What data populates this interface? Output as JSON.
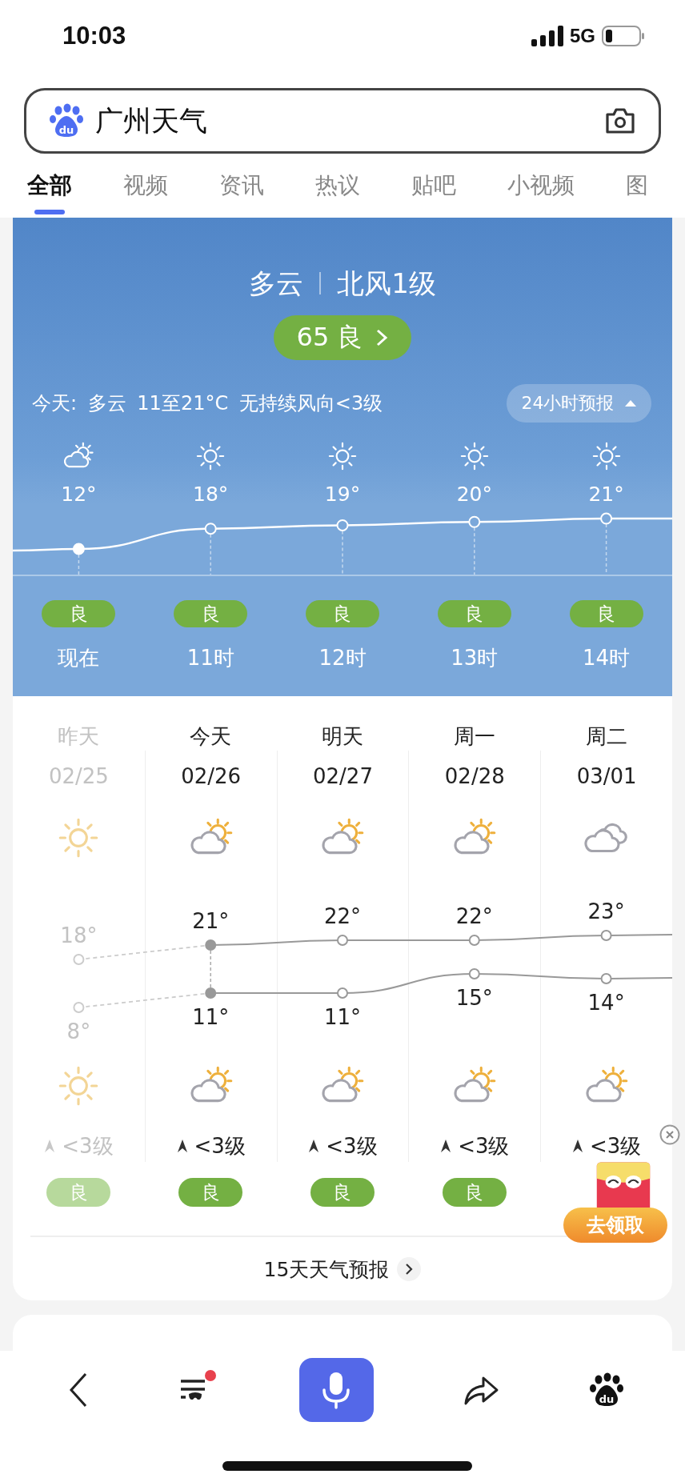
{
  "status_bar": {
    "time": "10:03",
    "network": "5G"
  },
  "search": {
    "logo_text": "du",
    "query": "广州天气"
  },
  "tabs": [
    {
      "label": "全部",
      "selected": true
    },
    {
      "label": "视频",
      "selected": false
    },
    {
      "label": "资讯",
      "selected": false
    },
    {
      "label": "热议",
      "selected": false
    },
    {
      "label": "贴吧",
      "selected": false
    },
    {
      "label": "小视频",
      "selected": false
    },
    {
      "label": "图",
      "selected": false
    }
  ],
  "current": {
    "condition": "多云",
    "wind": "北风1级",
    "aqi_value": "65",
    "aqi_label": "良"
  },
  "today_summary": "今天: 多云 11至21°C 无持续风向<3级",
  "forecast_button": {
    "label": "24小时预报",
    "expanded": true
  },
  "hourly": [
    {
      "weather": {
        "kind": "partly_cloudy"
      },
      "temp": "12°",
      "aqi": "良",
      "time": "现在",
      "selected": true
    },
    {
      "weather": {
        "kind": "sunny"
      },
      "temp": "18°",
      "aqi": "良",
      "time": "11时",
      "selected": false
    },
    {
      "weather": {
        "kind": "sunny"
      },
      "temp": "19°",
      "aqi": "良",
      "time": "12时",
      "selected": false
    },
    {
      "weather": {
        "kind": "sunny"
      },
      "temp": "20°",
      "aqi": "良",
      "time": "13时",
      "selected": false
    },
    {
      "weather": {
        "kind": "sunny"
      },
      "temp": "21°",
      "aqi": "良",
      "time": "14时",
      "selected": false
    }
  ],
  "daily": [
    {
      "day": "昨天",
      "date": "02/25",
      "day_weather": {
        "kind": "sunny"
      },
      "high": "18°",
      "low": "8°",
      "night_weather": {
        "kind": "sunny"
      },
      "wind": "<3级",
      "aqi": "良",
      "past": true,
      "selected": false
    },
    {
      "day": "今天",
      "date": "02/26",
      "day_weather": {
        "kind": "partly_cloudy"
      },
      "high": "21°",
      "low": "11°",
      "night_weather": {
        "kind": "partly_cloudy"
      },
      "wind": "<3级",
      "aqi": "良",
      "past": false,
      "selected": true
    },
    {
      "day": "明天",
      "date": "02/27",
      "day_weather": {
        "kind": "partly_cloudy"
      },
      "high": "22°",
      "low": "11°",
      "night_weather": {
        "kind": "partly_cloudy"
      },
      "wind": "<3级",
      "aqi": "良",
      "past": false,
      "selected": false
    },
    {
      "day": "周一",
      "date": "02/28",
      "day_weather": {
        "kind": "partly_cloudy"
      },
      "high": "22°",
      "low": "15°",
      "night_weather": {
        "kind": "partly_cloudy"
      },
      "wind": "<3级",
      "aqi": "良",
      "past": false,
      "selected": false
    },
    {
      "day": "周二",
      "date": "03/01",
      "day_weather": {
        "kind": "cloudy"
      },
      "high": "23°",
      "low": "14°",
      "night_weather": {
        "kind": "partly_cloudy"
      },
      "wind": "<3级",
      "past": false,
      "selected": false
    }
  ],
  "more_link": "15天天气预报",
  "promo": {
    "button": "去领取"
  },
  "bottom_nav": {
    "logo_text": "du",
    "has_notification": true
  }
}
